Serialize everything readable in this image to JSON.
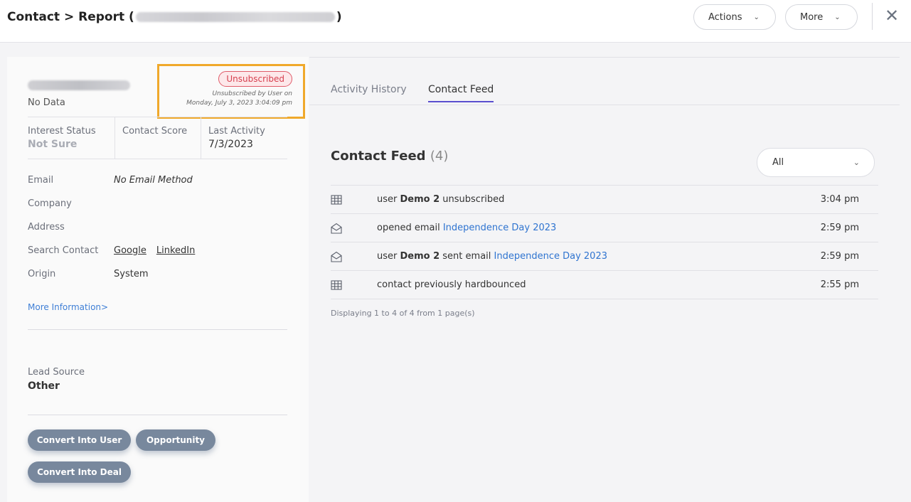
{
  "header": {
    "title_prefix": "Contact > Report (",
    "title_suffix": ")",
    "actions_label": "Actions",
    "more_label": "More",
    "close_glyph": "✕"
  },
  "contact": {
    "subtitle": "No Data",
    "unsubscribed_badge": "Unsubscribed",
    "unsubscribed_note_line1": "Unsubscribed by User on",
    "unsubscribed_note_line2": "Monday, July 3, 2023 3:04:09 pm",
    "stats": {
      "interest_status_label": "Interest Status",
      "interest_status_value": "Not Sure",
      "contact_score_label": "Contact Score",
      "contact_score_value": "",
      "last_activity_label": "Last Activity",
      "last_activity_value": "7/3/2023"
    },
    "fields": {
      "email_label": "Email",
      "email_value": "No Email Method",
      "company_label": "Company",
      "address_label": "Address",
      "search_label": "Search Contact",
      "search_google": "Google",
      "search_linkedin": "LinkedIn",
      "origin_label": "Origin",
      "origin_value": "System"
    },
    "more_info": "More Information>",
    "lead_source_label": "Lead Source",
    "lead_source_value": "Other",
    "buttons": {
      "convert_user": "Convert Into User",
      "opportunity": "Opportunity",
      "convert_deal": "Convert Into Deal"
    }
  },
  "tabs": {
    "activity_history": "Activity History",
    "contact_feed": "Contact Feed"
  },
  "feed": {
    "title": "Contact Feed",
    "count": "(4)",
    "filter_value": "All",
    "rows": [
      {
        "icon": "table-icon",
        "pre": "user ",
        "bold": "Demo 2",
        "mid": " unsubscribed",
        "link": "",
        "time": "3:04 pm"
      },
      {
        "icon": "envelope-open-icon",
        "pre": "opened email ",
        "bold": "",
        "mid": "",
        "link": "Independence Day 2023",
        "time": "2:59 pm"
      },
      {
        "icon": "envelope-open-icon",
        "pre": "user ",
        "bold": "Demo 2",
        "mid": " sent email ",
        "link": "Independence Day 2023",
        "time": "2:59 pm"
      },
      {
        "icon": "table-icon",
        "pre": "contact previously hardbounced",
        "bold": "",
        "mid": "",
        "link": "",
        "time": "2:55 pm"
      }
    ],
    "footer": "Displaying 1 to 4 of 4 from 1 page(s)"
  },
  "colors": {
    "accent_tab": "#5a4fcf",
    "link": "#2f74d0",
    "unsubscribed": "#d6404f",
    "highlight_box": "#f0a92b",
    "pill_button": "#78889d"
  }
}
